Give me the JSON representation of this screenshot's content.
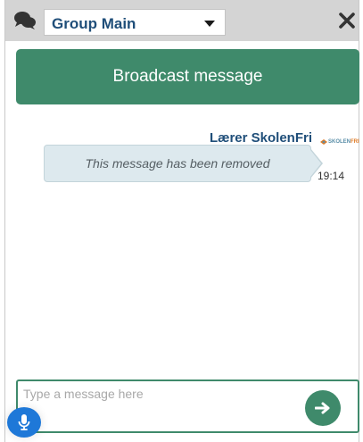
{
  "header": {
    "group_selected": "Group Main",
    "icons": {
      "chat": "chat-bubbles-icon",
      "dropdown": "chevron-down-icon",
      "close": "close-icon"
    }
  },
  "broadcast": {
    "label": "Broadcast message"
  },
  "messages": [
    {
      "sender": "Lærer SkolenFri",
      "text": "This message has been removed",
      "time": "19:14",
      "logo": {
        "part1": "SKOLEN",
        "part2": "FRI"
      }
    }
  ],
  "composer": {
    "placeholder": "Type a message here",
    "value": "",
    "send_icon": "arrow-right-icon",
    "mic_icon": "microphone-icon"
  },
  "colors": {
    "accent": "#3f8a6b",
    "header_bg": "#d4d4d4",
    "name_blue": "#1f4e79",
    "bubble_bg": "#dde9ee",
    "mic_blue": "#1e78d8"
  }
}
